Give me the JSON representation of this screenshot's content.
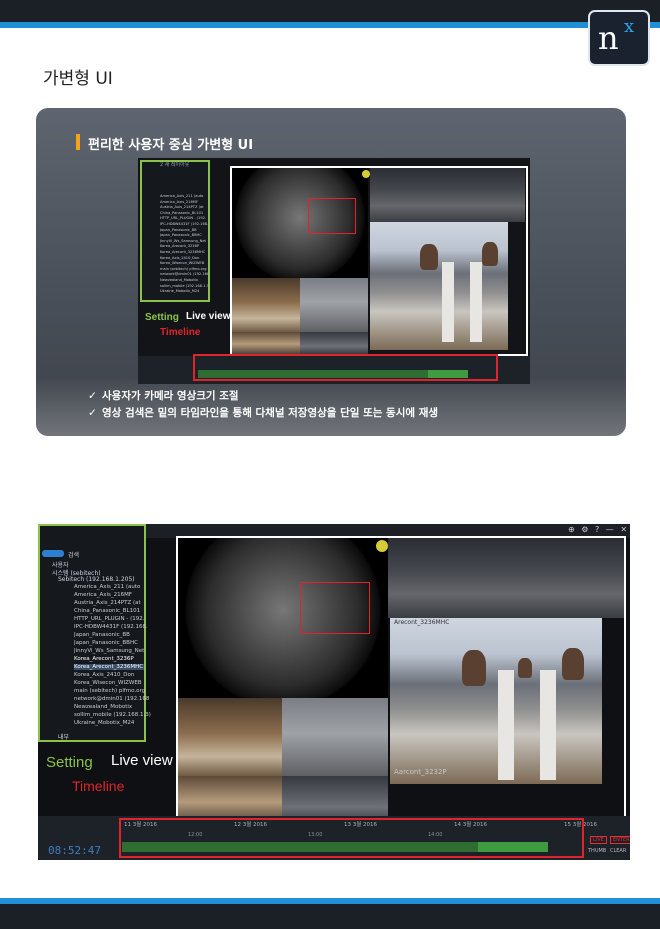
{
  "brand": {
    "logo_main": "n",
    "logo_sup": "x"
  },
  "page_title": "가변형 UI",
  "panel": {
    "title": "편리한 사용자 중심 가변형 UI",
    "bullets": [
      "사용자가 카메라 영상크기 조절",
      "영상 검색은 밑의 타임라인을 통해 다채널 저장영상을 단일 또는 동시에 재생"
    ]
  },
  "labels": {
    "setting": "Setting",
    "live_view": "Live view",
    "timeline": "Timeline"
  },
  "client": {
    "tab_title": "2 새 레이아웃",
    "search_label": "검색",
    "users_label": "사용자",
    "system_label": "시스템 (sebitech)",
    "server_label": "Sebitech (192.168.1.205)",
    "tree_items": [
      "America_Axis_211 (auto",
      "America_Axis_216MF",
      "Austria_Axis_214PTZ (at",
      "China_Panasonic_BL101",
      "HTTP_URL_PLUGIN - (192.",
      "IPC-HDBW4431F (192.168.",
      "Japan_Panasonic_BB",
      "Japan_Panasonic_BBHC",
      "JinnyVi_Ws_Samsung_Net",
      "Korea_Arecont_3236P",
      "Korea_Arecont_3236MHC",
      "Korea_Axis_2410_Don",
      "Korea_Wisecon_WIZWEB",
      "main (sebitech) plfmo.org",
      "network@dmin01 (192.168",
      "Newzealand_Mobotix",
      "sollim_mobile (192.168.1.3)",
      "Ukraine_Mobotix_M24"
    ],
    "layouts_label": "내부",
    "timeline_dates": [
      "11 3월 2016",
      "12 3월 2016",
      "13 3월 2016",
      "14 3월 2016",
      "15 3월 2016"
    ],
    "timeline_hours": [
      "12:00",
      "13:00",
      "14:00"
    ],
    "clock": "08:52:47",
    "camera_overlay": "Aarcont_3232P",
    "office_cam_title": "Arecont_3236MHC",
    "buttons": {
      "live": "LIVE",
      "enter": "ENTER",
      "thumb": "THUMB",
      "clear": "CLEAR"
    },
    "window_controls": [
      "⊕",
      "⚙",
      "?",
      "—",
      "✕"
    ]
  }
}
